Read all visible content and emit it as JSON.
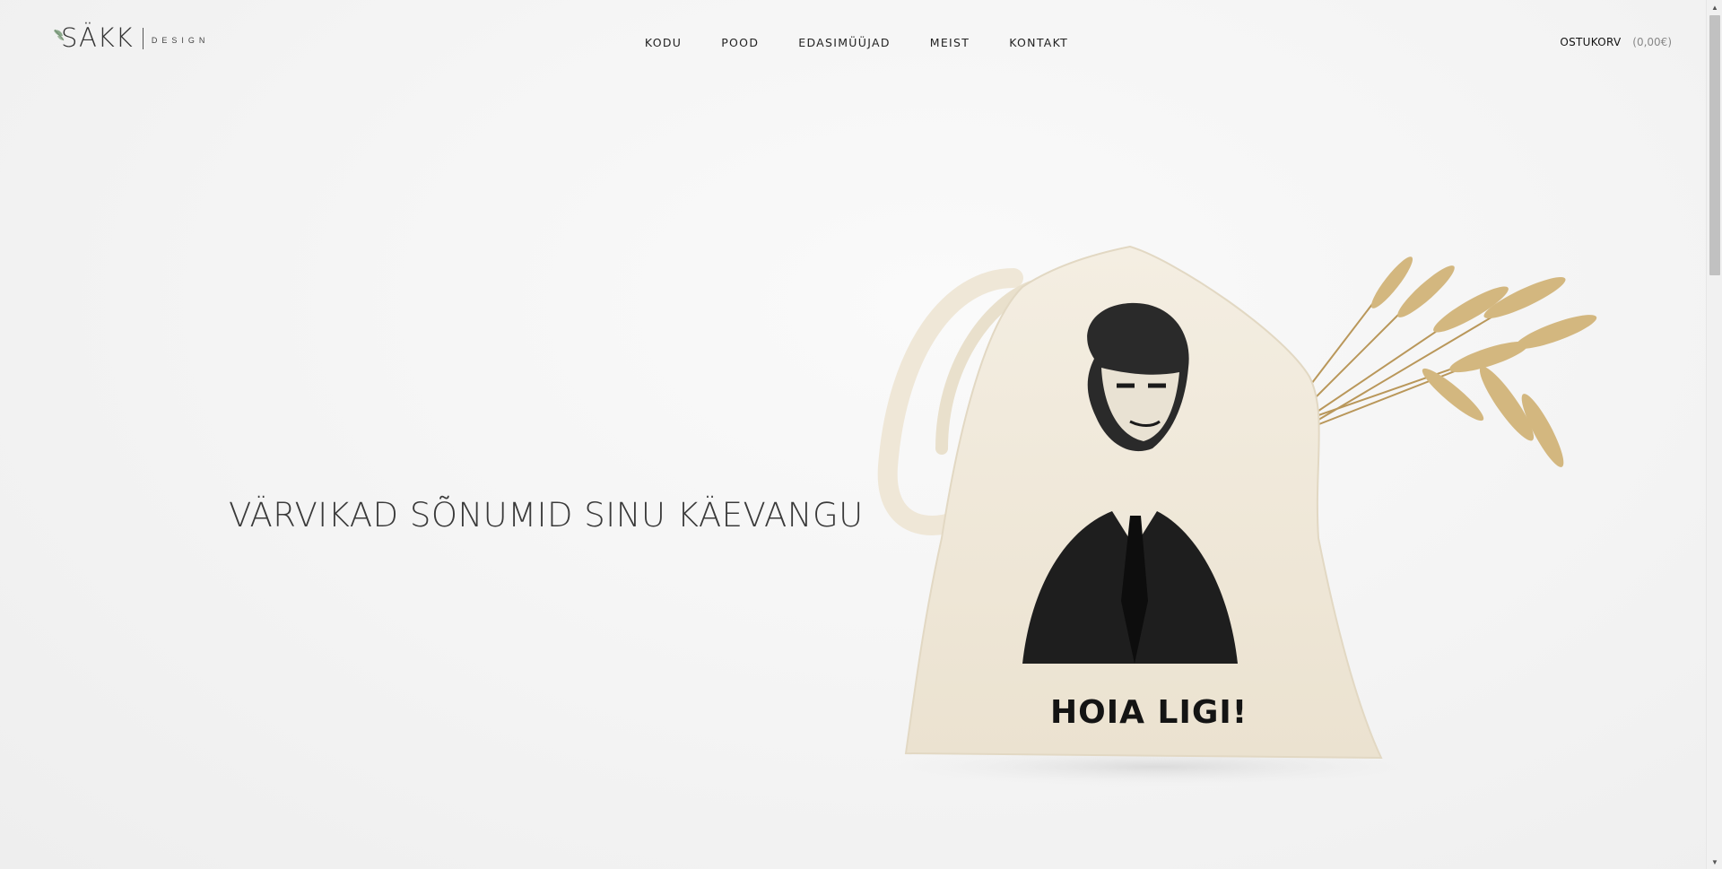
{
  "header": {
    "logo": {
      "main": "SÄKK",
      "sub": "DESIGN"
    },
    "nav": [
      {
        "label": "KODU"
      },
      {
        "label": "POOD"
      },
      {
        "label": "EDASIMÜÜJAD"
      },
      {
        "label": "MEIST"
      },
      {
        "label": "KONTAKT"
      }
    ],
    "cart": {
      "label": "OSTUKORV",
      "total": "(0,00€)"
    }
  },
  "hero": {
    "headline": "VÄRVIKAD SÕNUMID SINU KÄEVANGU",
    "product": {
      "print_text": "HOIA LIGI!",
      "image": "tote-bag-with-wheat"
    }
  },
  "colors": {
    "background": "#f4f4f4",
    "text": "#222222",
    "bag": "#f2ebdd",
    "wheat": "#c9a968"
  }
}
